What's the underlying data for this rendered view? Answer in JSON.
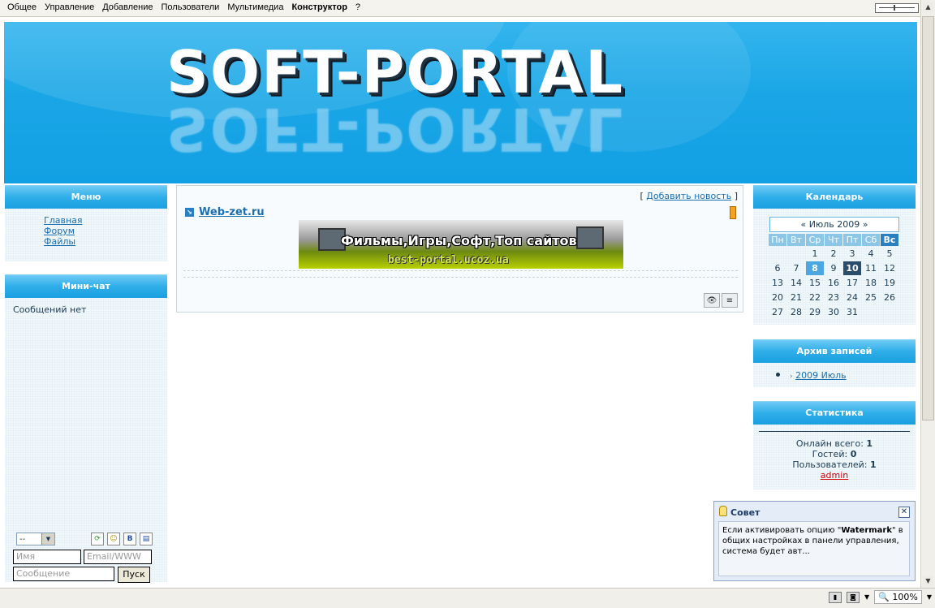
{
  "topbar": {
    "menu": [
      "Общее",
      "Управление",
      "Добавление",
      "Пользователи",
      "Мультимедиа",
      "Конструктор",
      "?"
    ]
  },
  "banner": {
    "logo": "SOFT-PORTAL",
    "logo_reflection": "SOFT-PORTAL"
  },
  "left": {
    "menu_title": "Меню",
    "menu_items": [
      "Главная",
      "Форум",
      "Файлы"
    ],
    "chat_title": "Мини-чат",
    "chat_empty": "Сообщений нет",
    "chat_select": "--",
    "chat_icons": [
      "refresh-icon",
      "smiley-icon",
      "bbcode-icon",
      "clipboard-icon"
    ],
    "name_placeholder": "Имя",
    "email_placeholder": "Email/WWW",
    "message_placeholder": "Сообщение",
    "send_label": "Пуск"
  },
  "center": {
    "add_news_open": "[",
    "add_news": "Добавить новость",
    "add_news_close": "]",
    "news_title": "Web-zet.ru",
    "ad_text1": "Фильмы,Игры,Софт,Топ сайтов",
    "ad_text2": "best-portal.ucoz.ua"
  },
  "right": {
    "calendar_title": "Календарь",
    "calendar_month": "«  Июль 2009  »",
    "weekdays": [
      "Пн",
      "Вт",
      "Ср",
      "Чт",
      "Пт",
      "Сб",
      "Вс"
    ],
    "days": [
      "",
      "",
      "1",
      "2",
      "3",
      "4",
      "5",
      "6",
      "7",
      "8",
      "9",
      "10",
      "11",
      "12",
      "13",
      "14",
      "15",
      "16",
      "17",
      "18",
      "19",
      "20",
      "21",
      "22",
      "23",
      "24",
      "25",
      "26",
      "27",
      "28",
      "29",
      "30",
      "31",
      "",
      ""
    ],
    "selected_day": "8",
    "today_day": "10",
    "archive_title": "Архив записей",
    "archive_item": "2009 Июль",
    "stats_title": "Статистика",
    "stats_online_label": "Онлайн всего:",
    "stats_online": "1",
    "stats_guests_label": "Гостей:",
    "stats_guests": "0",
    "stats_users_label": "Пользователей:",
    "stats_users": "1",
    "stats_admin": "admin"
  },
  "tip": {
    "title": "Совет",
    "text_before": "Если активировать опцию \"",
    "text_bold": "Watermark",
    "text_after": "\" в общих настройках в панели управления, система будет авт..."
  },
  "statusbar": {
    "zoom": "100%"
  },
  "colors": {
    "banner": "#1aa6e6",
    "block_title": "#2eaee9",
    "link": "#1a6fb0",
    "admin": "#cc0000"
  }
}
